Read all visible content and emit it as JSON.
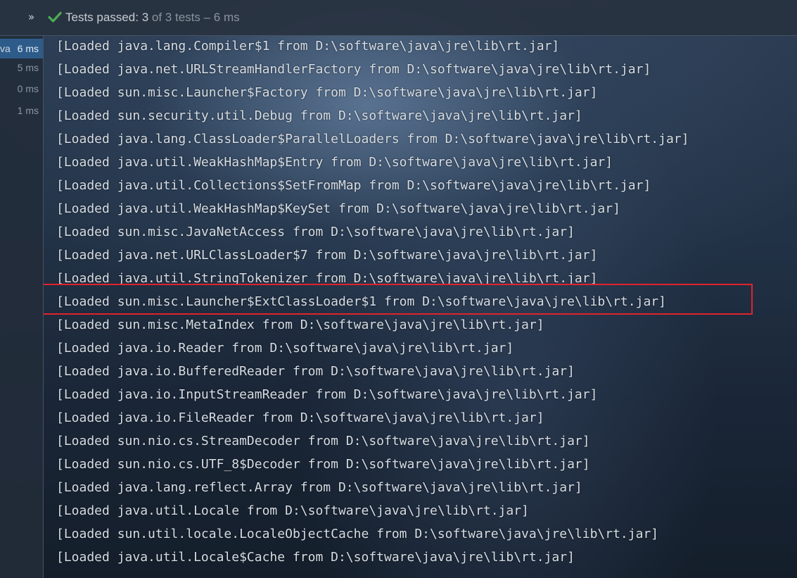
{
  "toolbar": {
    "expand_glyph": "»",
    "status_label": "Tests passed:",
    "passed_count": "3",
    "of_text": "of 3 tests – 6 ms",
    "check_color": "#4caf50"
  },
  "tree": {
    "clip_text": "va",
    "items": [
      {
        "time": "6 ms"
      },
      {
        "time": "5 ms"
      },
      {
        "time": "0 ms"
      },
      {
        "time": "1 ms"
      }
    ]
  },
  "console": {
    "highlight_color": "#e0232d",
    "lines": [
      "[Loaded java.lang.Compiler$1 from D:\\software\\java\\jre\\lib\\rt.jar]",
      "[Loaded java.net.URLStreamHandlerFactory from D:\\software\\java\\jre\\lib\\rt.jar]",
      "[Loaded sun.misc.Launcher$Factory from D:\\software\\java\\jre\\lib\\rt.jar]",
      "[Loaded sun.security.util.Debug from D:\\software\\java\\jre\\lib\\rt.jar]",
      "[Loaded java.lang.ClassLoader$ParallelLoaders from D:\\software\\java\\jre\\lib\\rt.jar]",
      "[Loaded java.util.WeakHashMap$Entry from D:\\software\\java\\jre\\lib\\rt.jar]",
      "[Loaded java.util.Collections$SetFromMap from D:\\software\\java\\jre\\lib\\rt.jar]",
      "[Loaded java.util.WeakHashMap$KeySet from D:\\software\\java\\jre\\lib\\rt.jar]",
      "[Loaded sun.misc.JavaNetAccess from D:\\software\\java\\jre\\lib\\rt.jar]",
      "[Loaded java.net.URLClassLoader$7 from D:\\software\\java\\jre\\lib\\rt.jar]",
      "[Loaded java.util.StringTokenizer from D:\\software\\java\\jre\\lib\\rt.jar]",
      "[Loaded sun.misc.Launcher$ExtClassLoader$1 from D:\\software\\java\\jre\\lib\\rt.jar]",
      "[Loaded sun.misc.MetaIndex from D:\\software\\java\\jre\\lib\\rt.jar]",
      "[Loaded java.io.Reader from D:\\software\\java\\jre\\lib\\rt.jar]",
      "[Loaded java.io.BufferedReader from D:\\software\\java\\jre\\lib\\rt.jar]",
      "[Loaded java.io.InputStreamReader from D:\\software\\java\\jre\\lib\\rt.jar]",
      "[Loaded java.io.FileReader from D:\\software\\java\\jre\\lib\\rt.jar]",
      "[Loaded sun.nio.cs.StreamDecoder from D:\\software\\java\\jre\\lib\\rt.jar]",
      "[Loaded sun.nio.cs.UTF_8$Decoder from D:\\software\\java\\jre\\lib\\rt.jar]",
      "[Loaded java.lang.reflect.Array from D:\\software\\java\\jre\\lib\\rt.jar]",
      "[Loaded java.util.Locale from D:\\software\\java\\jre\\lib\\rt.jar]",
      "[Loaded sun.util.locale.LocaleObjectCache from D:\\software\\java\\jre\\lib\\rt.jar]",
      "[Loaded java.util.Locale$Cache from D:\\software\\java\\jre\\lib\\rt.jar]"
    ]
  }
}
